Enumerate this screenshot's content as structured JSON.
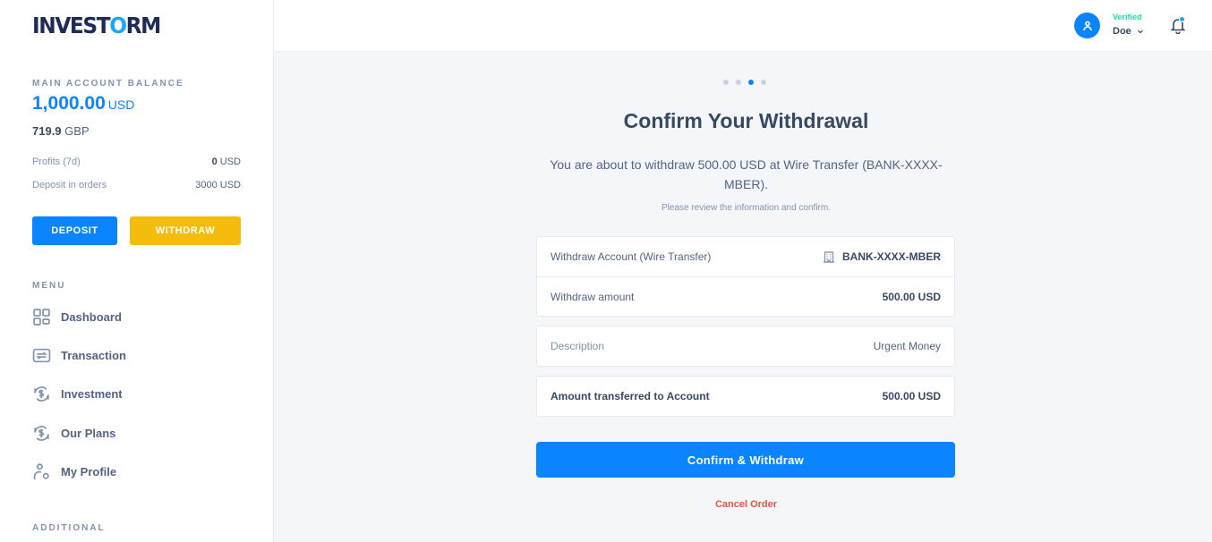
{
  "app": {
    "logo_prefix": "INVEST",
    "logo_o": "O",
    "logo_suffix": "RM"
  },
  "sidebar": {
    "balance_label": "MAIN ACCOUNT BALANCE",
    "balance_amount": "1,000.00",
    "balance_currency": "USD",
    "secondary_amount": "719.9",
    "secondary_currency": "GBP",
    "stats": [
      {
        "label": "Profits (7d)",
        "value_bold": "0",
        "value_rest": " USD"
      },
      {
        "label": "Deposit in orders",
        "value_bold": "",
        "value_rest": "3000 USD"
      }
    ],
    "deposit_label": "DEPOSIT",
    "withdraw_label": "WITHDRAW",
    "menu_label": "MENU",
    "menu_items": [
      {
        "label": "Dashboard",
        "icon": "dashboard-icon"
      },
      {
        "label": "Transaction",
        "icon": "transaction-icon"
      },
      {
        "label": "Investment",
        "icon": "investment-icon"
      },
      {
        "label": "Our Plans",
        "icon": "plans-icon"
      },
      {
        "label": "My Profile",
        "icon": "profile-icon"
      }
    ],
    "additional_label": "ADDITIONAL"
  },
  "header": {
    "status": "Verified",
    "user_name": "Doe",
    "status_color": "#1ee0ac",
    "notification_dot": true
  },
  "main": {
    "steps_total": 4,
    "steps_active": 3,
    "title": "Confirm Your Withdrawal",
    "description": "You are about to withdraw 500.00 USD at Wire Transfer (BANK-XXXX-MBER).",
    "note": "Please review the information and confirm.",
    "details": [
      {
        "label": "Withdraw Account (Wire Transfer)",
        "value": "BANK-XXXX-MBER"
      },
      {
        "label": "Withdraw amount",
        "value": "500.00 USD"
      }
    ],
    "description_row": {
      "label": "Description",
      "value": "Urgent Money"
    },
    "total_row": {
      "label": "Amount transferred to Account",
      "value": "500.00 USD"
    },
    "confirm_label": "Confirm & Withdraw",
    "cancel_label": "Cancel Order",
    "accent": "#0a84ff",
    "cancel_color": "#e85347"
  }
}
